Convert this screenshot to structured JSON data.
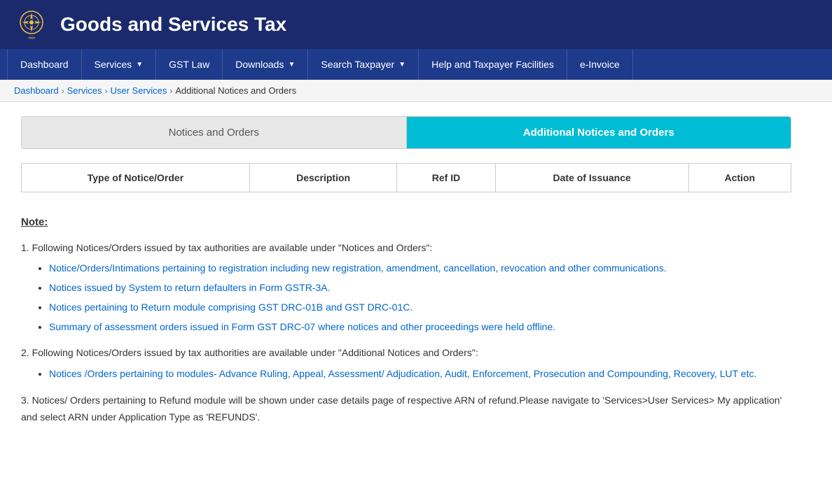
{
  "header": {
    "title": "Goods and Services Tax",
    "logo_alt": "India Government Emblem"
  },
  "navbar": {
    "items": [
      {
        "label": "Dashboard",
        "has_arrow": false,
        "id": "dashboard"
      },
      {
        "label": "Services",
        "has_arrow": true,
        "id": "services"
      },
      {
        "label": "GST Law",
        "has_arrow": false,
        "id": "gst-law"
      },
      {
        "label": "Downloads",
        "has_arrow": true,
        "id": "downloads"
      },
      {
        "label": "Search Taxpayer",
        "has_arrow": true,
        "id": "search-taxpayer"
      },
      {
        "label": "Help and Taxpayer Facilities",
        "has_arrow": false,
        "id": "help"
      },
      {
        "label": "e-Invoice",
        "has_arrow": false,
        "id": "e-invoice"
      }
    ]
  },
  "breadcrumb": {
    "items": [
      {
        "label": "Dashboard",
        "link": true
      },
      {
        "label": "Services",
        "link": true
      },
      {
        "label": "User Services",
        "link": true
      },
      {
        "label": "Additional Notices and Orders",
        "link": false
      }
    ]
  },
  "tabs": {
    "inactive_label": "Notices and Orders",
    "active_label": "Additional Notices and Orders"
  },
  "table": {
    "headers": [
      "Type of Notice/Order",
      "Description",
      "Ref ID",
      "Date of Issuance",
      "Action"
    ]
  },
  "note": {
    "heading": "Note:",
    "items": [
      {
        "id": 1,
        "text": "Following Notices/Orders issued by tax authorities are available under \"Notices and Orders\":",
        "sub_items": [
          "Notice/Orders/Intimations pertaining to registration including new registration, amendment, cancellation, revocation and other communications.",
          "Notices issued by System to return defaulters in Form GSTR-3A.",
          "Notices pertaining to Return module comprising GST DRC-01B and GST DRC-01C.",
          "Summary of assessment orders issued in Form GST DRC-07 where notices and other proceedings were held offline."
        ]
      },
      {
        "id": 2,
        "text": "Following Notices/Orders issued by tax authorities are available under \"Additional Notices and Orders\":",
        "sub_items": [
          "Notices /Orders pertaining to modules- Advance Ruling, Appeal, Assessment/ Adjudication, Audit, Enforcement, Prosecution and Compounding, Recovery, LUT etc."
        ]
      },
      {
        "id": 3,
        "text": "Notices/ Orders pertaining to Refund module will be shown under case details page of respective ARN of refund.Please navigate to 'Services>User Services> My application' and select ARN under Application Type as 'REFUNDS'.",
        "sub_items": []
      }
    ]
  }
}
